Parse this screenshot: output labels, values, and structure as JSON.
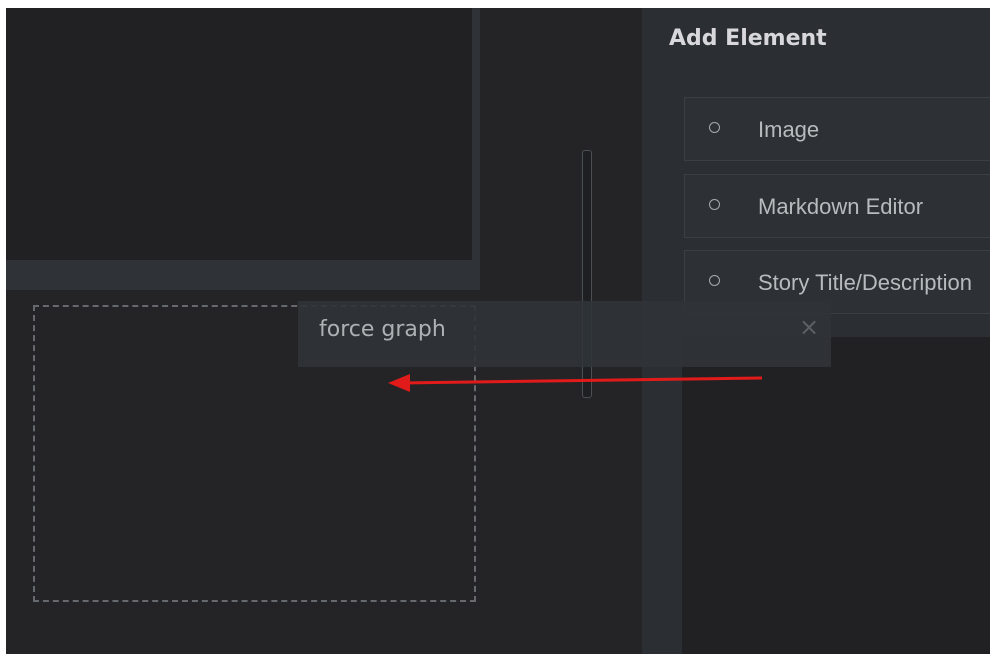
{
  "panel": {
    "title": "Add Element",
    "items": [
      {
        "label": "Image"
      },
      {
        "label": "Markdown Editor"
      },
      {
        "label": "Story Title/Description"
      }
    ]
  },
  "drag_chip": {
    "label": "force graph"
  },
  "colors": {
    "arrow": "#e11a1a"
  }
}
